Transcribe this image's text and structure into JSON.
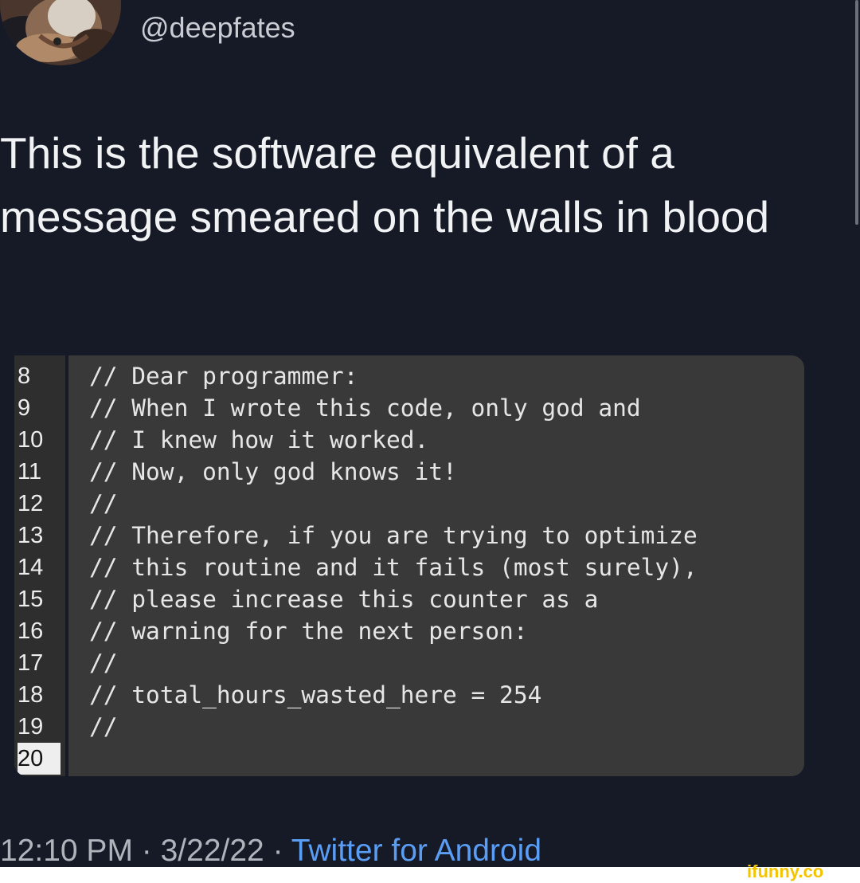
{
  "tweet": {
    "handle": "@deepfates",
    "text": "This is the software equivalent of a message smeared on the walls in blood",
    "time": "12:10 PM",
    "separator_1": " · ",
    "date": "3/22/22",
    "separator_2": " · ",
    "source": "Twitter for Android"
  },
  "code_block": {
    "lines": [
      {
        "number": "8",
        "text": "// Dear programmer:"
      },
      {
        "number": "9",
        "text": "// When I wrote this code, only god and"
      },
      {
        "number": "10",
        "text": "// I knew how it worked."
      },
      {
        "number": "11",
        "text": "// Now, only god knows it!"
      },
      {
        "number": "12",
        "text": "//"
      },
      {
        "number": "13",
        "text": "// Therefore, if you are trying to optimize"
      },
      {
        "number": "14",
        "text": "// this routine and it fails (most surely),"
      },
      {
        "number": "15",
        "text": "// please increase this counter as a"
      },
      {
        "number": "16",
        "text": "// warning for the next person:"
      },
      {
        "number": "17",
        "text": "//"
      },
      {
        "number": "18",
        "text": "// total_hours_wasted_here = 254"
      },
      {
        "number": "19",
        "text": "//"
      },
      {
        "number": "20",
        "text": ""
      }
    ]
  },
  "watermark": {
    "text": "ifunny.co"
  },
  "colors": {
    "background": "#161a27",
    "code_background": "#393939",
    "link": "#5a9df5",
    "watermark": "#f4c400"
  }
}
